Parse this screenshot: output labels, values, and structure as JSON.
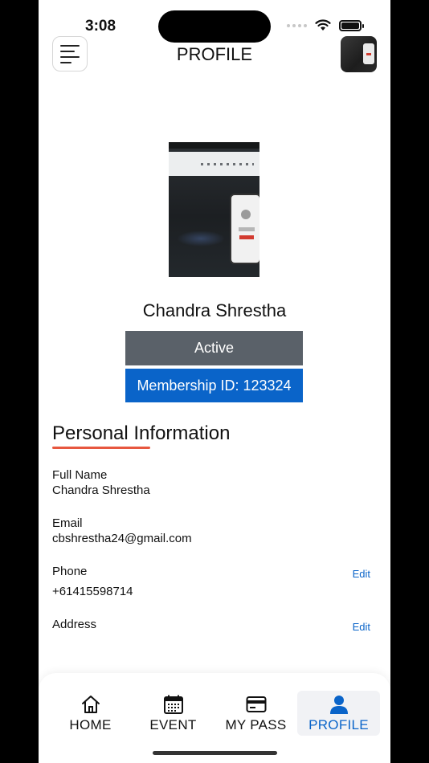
{
  "status_bar": {
    "time": "3:08"
  },
  "header": {
    "title": "PROFILE"
  },
  "profile": {
    "name": "Chandra Shrestha",
    "status": "Active",
    "membership": "Membership ID: 123324"
  },
  "personal_info": {
    "title": "Personal Information",
    "full_name_label": "Full Name",
    "full_name_value": "Chandra Shrestha",
    "email_label": "Email",
    "email_value": "cbshrestha24@gmail.com",
    "phone_label": "Phone",
    "phone_value": "+61415598714",
    "address_label": "Address",
    "edit_label": "Edit"
  },
  "tabs": [
    {
      "label": "HOME",
      "icon": "home-icon"
    },
    {
      "label": "EVENT",
      "icon": "calendar-icon"
    },
    {
      "label": "MY PASS",
      "icon": "card-icon"
    },
    {
      "label": "PROFILE",
      "icon": "person-icon",
      "active": true
    }
  ],
  "colors": {
    "accent": "#0a64c9",
    "status_bg": "#5a6169",
    "underline": "#e7573f"
  }
}
